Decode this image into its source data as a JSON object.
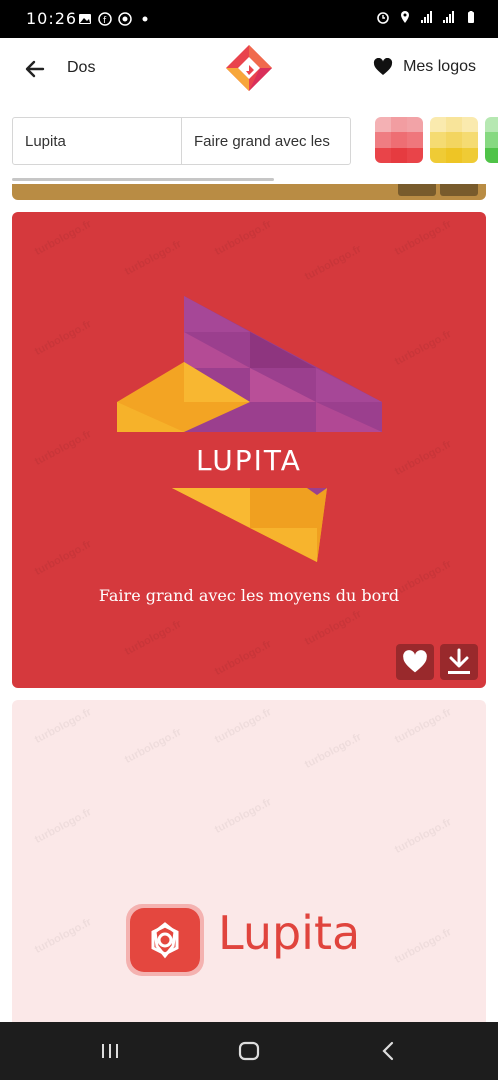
{
  "status_bar": {
    "time": "10:26",
    "left_icons": [
      "image-icon",
      "facebook-icon",
      "whatsapp-icon",
      "dot-icon"
    ],
    "right_icons": [
      "alarm-icon",
      "location-icon",
      "signal-icon",
      "lte-icon",
      "battery-icon"
    ]
  },
  "app_bar": {
    "back_label": "Dos",
    "favorites_label": "Mes logos"
  },
  "filters": {
    "name_value": "Lupita",
    "slogan_value": "Faire grand avec les",
    "palettes": [
      {
        "name": "red",
        "colors": [
          "#f4aaad",
          "#f28a8e",
          "#ef6a6e",
          "#e94b50"
        ]
      },
      {
        "name": "yellow",
        "colors": [
          "#f9e7a3",
          "#f6dc74",
          "#f1cf46",
          "#ecc21c"
        ]
      },
      {
        "name": "green",
        "colors": [
          "#a6e3a1",
          "#6fd06a"
        ]
      }
    ]
  },
  "cards": [
    {
      "brand": "LUPITA",
      "slogan": "Faire grand avec les moyens du bord",
      "background": "#d5393d"
    },
    {
      "brand": "Lupita",
      "background": "#fbe8e8",
      "accent": "#e0443d"
    }
  ],
  "watermark_text": "turbologo.fr",
  "nav_bar": {
    "icons": [
      "recent-apps-icon",
      "home-icon",
      "back-icon"
    ]
  }
}
